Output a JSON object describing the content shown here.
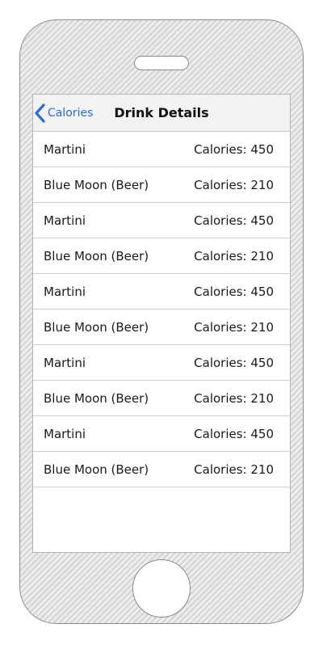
{
  "nav": {
    "back_label": "Calories",
    "title": "Drink Details"
  },
  "drinks": [
    {
      "name": "Martini",
      "calories": "Calories: 450"
    },
    {
      "name": "Blue Moon (Beer)",
      "calories": "Calories: 210"
    },
    {
      "name": "Martini",
      "calories": "Calories: 450"
    },
    {
      "name": "Blue Moon (Beer)",
      "calories": "Calories: 210"
    },
    {
      "name": "Martini",
      "calories": "Calories: 450"
    },
    {
      "name": "Blue Moon (Beer)",
      "calories": "Calories: 210"
    },
    {
      "name": "Martini",
      "calories": "Calories: 450"
    },
    {
      "name": "Blue Moon (Beer)",
      "calories": "Calories: 210"
    },
    {
      "name": "Martini",
      "calories": "Calories: 450"
    },
    {
      "name": "Blue Moon (Beer)",
      "calories": "Calories: 210"
    }
  ],
  "colors": {
    "accent": "#2a6fd6",
    "nav_background": "#f2f2f2",
    "device_frame": "#d9d9d9"
  },
  "icons": {
    "back": "chevron-left-icon"
  }
}
